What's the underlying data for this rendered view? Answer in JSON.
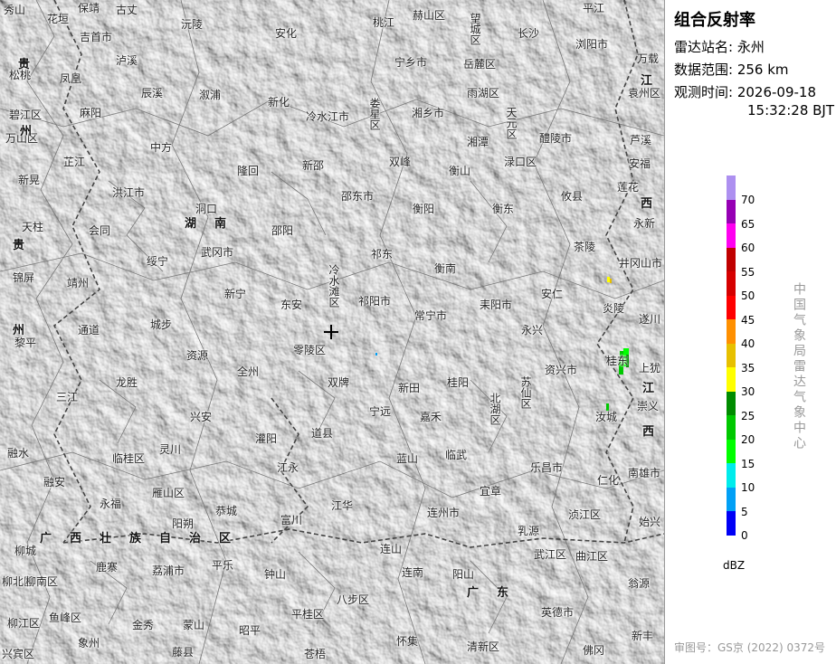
{
  "product": {
    "title": "组合反射率",
    "station_label": "雷达站名:",
    "station_value": "永州",
    "range_label": "数据范围:",
    "range_value": "256 km",
    "time_label": "观测时间:",
    "time_date": "2026-09-18",
    "time_clock": "15:32:28 BJT"
  },
  "legend": {
    "unit": "dBZ",
    "ticks": [
      "70",
      "65",
      "60",
      "55",
      "50",
      "45",
      "40",
      "35",
      "30",
      "25",
      "20",
      "15",
      "10",
      "5",
      "0"
    ],
    "colors": [
      "#ad90f0",
      "#9600b4",
      "#ff00f0",
      "#c00000",
      "#d60000",
      "#ff0000",
      "#ff9000",
      "#e7c000",
      "#ffff00",
      "#008c00",
      "#00c800",
      "#00ff00",
      "#00ecec",
      "#01a0f6",
      "#0000f6"
    ]
  },
  "source_vertical": "中国气象局雷达气象中心",
  "approval": "审图号：GS京 (2022) 0372号",
  "map": {
    "places": [
      {
        "name": "秀山"
      },
      {
        "name": "花垣"
      },
      {
        "name": "保靖"
      },
      {
        "name": "古丈"
      },
      {
        "name": "沅陵"
      },
      {
        "name": "安化"
      },
      {
        "name": "桃江"
      },
      {
        "name": "赫山区"
      },
      {
        "name": "望城区"
      },
      {
        "name": "长沙"
      },
      {
        "name": "平江"
      },
      {
        "name": "浏阳市"
      },
      {
        "name": "万载"
      },
      {
        "name": "吉首市"
      },
      {
        "name": "泸溪"
      },
      {
        "name": "宁乡市"
      },
      {
        "name": "岳麓区"
      },
      {
        "name": "松桃"
      },
      {
        "name": "凤凰"
      },
      {
        "name": "辰溪"
      },
      {
        "name": "溆浦"
      },
      {
        "name": "新化"
      },
      {
        "name": "雨湖区"
      },
      {
        "name": "袁州区"
      },
      {
        "name": "碧江区"
      },
      {
        "name": "万山区"
      },
      {
        "name": "麻阳"
      },
      {
        "name": "冷水江市"
      },
      {
        "name": "娄星区"
      },
      {
        "name": "湘乡市"
      },
      {
        "name": "天元区"
      },
      {
        "name": "醴陵市"
      },
      {
        "name": "芦溪"
      },
      {
        "name": "中方"
      },
      {
        "name": "湘潭"
      },
      {
        "name": "芷江"
      },
      {
        "name": "隆回"
      },
      {
        "name": "新邵"
      },
      {
        "name": "双峰"
      },
      {
        "name": "衡山"
      },
      {
        "name": "渌口区"
      },
      {
        "name": "安福"
      },
      {
        "name": "新晃"
      },
      {
        "name": "洪江市"
      },
      {
        "name": "邵东市"
      },
      {
        "name": "攸县"
      },
      {
        "name": "莲花"
      },
      {
        "name": "洞口"
      },
      {
        "name": "衡阳"
      },
      {
        "name": "衡东"
      },
      {
        "name": "天柱"
      },
      {
        "name": "会同"
      },
      {
        "name": "邵阳"
      },
      {
        "name": "永新"
      },
      {
        "name": "茶陵"
      },
      {
        "name": "武冈市"
      },
      {
        "name": "祁东"
      },
      {
        "name": "锦屏"
      },
      {
        "name": "绥宁"
      },
      {
        "name": "衡南"
      },
      {
        "name": "井冈山市"
      },
      {
        "name": "靖州"
      },
      {
        "name": "新宁"
      },
      {
        "name": "东安"
      },
      {
        "name": "冷水滩区"
      },
      {
        "name": "祁阳市"
      },
      {
        "name": "常宁市"
      },
      {
        "name": "耒阳市"
      },
      {
        "name": "安仁"
      },
      {
        "name": "炎陵"
      },
      {
        "name": "遂川"
      },
      {
        "name": "黎平"
      },
      {
        "name": "通道"
      },
      {
        "name": "城步"
      },
      {
        "name": "零陵区"
      },
      {
        "name": "永兴"
      },
      {
        "name": "资源"
      },
      {
        "name": "全州"
      },
      {
        "name": "资兴市"
      },
      {
        "name": "桂东"
      },
      {
        "name": "上犹"
      },
      {
        "name": "龙胜"
      },
      {
        "name": "双牌"
      },
      {
        "name": "新田"
      },
      {
        "name": "桂阳"
      },
      {
        "name": "苏仙区"
      },
      {
        "name": "三江"
      },
      {
        "name": "兴安"
      },
      {
        "name": "宁远"
      },
      {
        "name": "嘉禾"
      },
      {
        "name": "北湖区"
      },
      {
        "name": "崇义"
      },
      {
        "name": "汝城"
      },
      {
        "name": "灌阳"
      },
      {
        "name": "道县"
      },
      {
        "name": "融水"
      },
      {
        "name": "临桂区"
      },
      {
        "name": "灵川"
      },
      {
        "name": "临武"
      },
      {
        "name": "蓝山"
      },
      {
        "name": "乐昌市"
      },
      {
        "name": "南雄市"
      },
      {
        "name": "融安"
      },
      {
        "name": "江永"
      },
      {
        "name": "仁化"
      },
      {
        "name": "永福"
      },
      {
        "name": "雁山区"
      },
      {
        "name": "宜章"
      },
      {
        "name": "恭城"
      },
      {
        "name": "江华"
      },
      {
        "name": "连州市"
      },
      {
        "name": "富川"
      },
      {
        "name": "浈江区"
      },
      {
        "name": "始兴"
      },
      {
        "name": "阳朔"
      },
      {
        "name": "柳城"
      },
      {
        "name": "乳源"
      },
      {
        "name": "鹿寨"
      },
      {
        "name": "荔浦市"
      },
      {
        "name": "连山"
      },
      {
        "name": "武江区"
      },
      {
        "name": "曲江区"
      },
      {
        "name": "平乐"
      },
      {
        "name": "柳北区"
      },
      {
        "name": "钟山"
      },
      {
        "name": "连南"
      },
      {
        "name": "阳山"
      },
      {
        "name": "翁源"
      },
      {
        "name": "柳南区"
      },
      {
        "name": "八步区"
      },
      {
        "name": "柳江区"
      },
      {
        "name": "鱼峰区"
      },
      {
        "name": "金秀"
      },
      {
        "name": "蒙山"
      },
      {
        "name": "昭平"
      },
      {
        "name": "平桂区"
      },
      {
        "name": "英德市"
      },
      {
        "name": "新丰"
      },
      {
        "name": "象州"
      },
      {
        "name": "兴宾区"
      },
      {
        "name": "藤县"
      },
      {
        "name": "苍梧"
      },
      {
        "name": "怀集"
      },
      {
        "name": "清新区"
      },
      {
        "name": "佛冈"
      }
    ],
    "regions": [
      {
        "name": "湖 南"
      },
      {
        "name": "广 西 壮 族 自 治 区"
      },
      {
        "name": "广 东"
      }
    ],
    "side_labels": [
      "贵",
      "州",
      "贵",
      "州",
      "江",
      "西",
      "江",
      "西"
    ]
  }
}
